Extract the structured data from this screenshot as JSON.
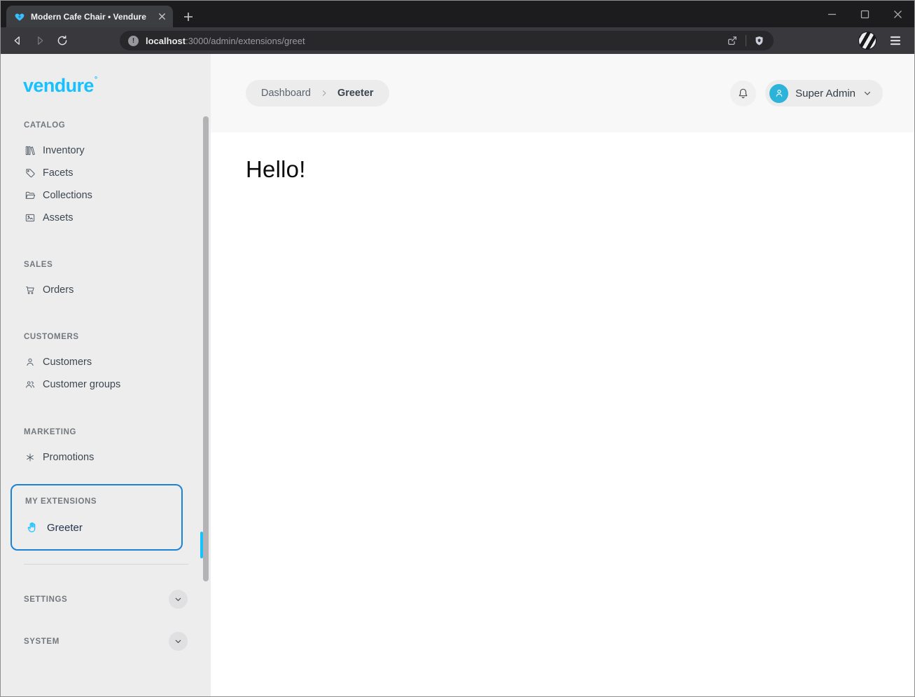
{
  "browser": {
    "tab_title": "Modern Cafe Chair • Vendure",
    "url_host": "localhost",
    "url_rest": ":3000/admin/extensions/greet",
    "toolbar_icons": [
      "back-icon",
      "forward-icon",
      "reload-icon",
      "share-icon",
      "brave-shield-icon",
      "profile-avatar",
      "menu-icon"
    ],
    "window_controls": [
      "minimize",
      "maximize",
      "close"
    ]
  },
  "sidebar": {
    "logo_text": "vendure",
    "logo_mark": "®",
    "sections": [
      {
        "label": "CATALOG",
        "items": [
          {
            "label": "Inventory",
            "icon": "library-icon"
          },
          {
            "label": "Facets",
            "icon": "tag-icon"
          },
          {
            "label": "Collections",
            "icon": "folder-icon"
          },
          {
            "label": "Assets",
            "icon": "image-icon"
          }
        ]
      },
      {
        "label": "SALES",
        "items": [
          {
            "label": "Orders",
            "icon": "cart-icon"
          }
        ]
      },
      {
        "label": "CUSTOMERS",
        "items": [
          {
            "label": "Customers",
            "icon": "user-icon"
          },
          {
            "label": "Customer groups",
            "icon": "users-icon"
          }
        ]
      },
      {
        "label": "MARKETING",
        "items": [
          {
            "label": "Promotions",
            "icon": "asterisk-icon"
          }
        ]
      }
    ],
    "extensions": {
      "label": "MY EXTENSIONS",
      "items": [
        {
          "label": "Greeter",
          "icon": "hand-icon",
          "active": true
        }
      ]
    },
    "collapsed_sections": [
      {
        "label": "SETTINGS"
      },
      {
        "label": "SYSTEM"
      }
    ]
  },
  "header": {
    "breadcrumb": [
      {
        "label": "Dashboard"
      },
      {
        "label": "Greeter"
      }
    ],
    "user_name": "Super Admin"
  },
  "content": {
    "greeting": "Hello!"
  },
  "colors": {
    "accent_blue": "#17c1ff",
    "selection_border": "#1b82d6",
    "avatar_bg": "#2bb3da",
    "sidebar_bg": "#ededee",
    "header_bg": "#f8f8f9",
    "chrome_bg": "#1c1c1e"
  }
}
